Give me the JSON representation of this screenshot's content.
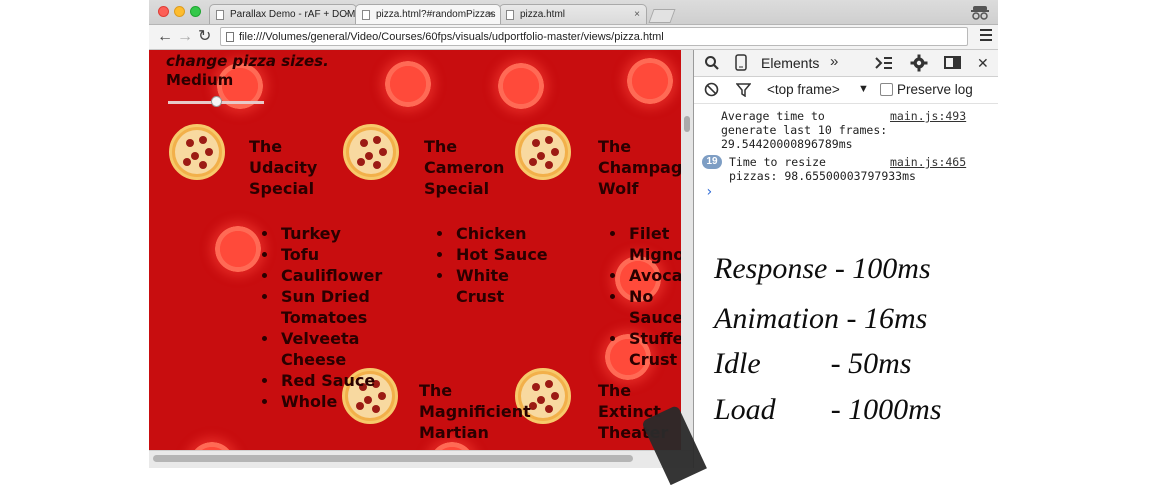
{
  "browser": {
    "tabs": [
      {
        "title": "Parallax Demo - rAF + DOM"
      },
      {
        "title": "pizza.html?#randomPizzas"
      },
      {
        "title": "pizza.html"
      }
    ],
    "close_glyph": "×",
    "url": "file:///Volumes/general/Video/Courses/60fps/visuals/udportfolio-master/views/pizza.html"
  },
  "page": {
    "header": "change pizza sizes.",
    "size_label": "Medium",
    "slider_level": 0.5,
    "pizzas": [
      {
        "name": [
          "The",
          "Udacity",
          "Special"
        ],
        "ingredients": [
          "Turkey",
          "Tofu",
          "Cauliflower",
          "Sun Dried Tomatoes",
          "Velveeta Cheese",
          "Red Sauce",
          "Whole"
        ]
      },
      {
        "name": [
          "The",
          "Cameron",
          "Special"
        ],
        "ingredients": [
          "Chicken",
          "Hot Sauce",
          "White Crust"
        ]
      },
      {
        "name": [
          "The",
          "Champag",
          "Wolf"
        ],
        "ingredients": [
          "Filet Migno",
          "Avoca",
          "No Sauce",
          "Stuffe Crust"
        ]
      },
      {
        "name": [
          "The",
          "Magnificient",
          "Martian"
        ],
        "ingredients": []
      },
      {
        "name": [
          "The",
          "Extinct",
          "Theater"
        ],
        "ingredients": []
      }
    ]
  },
  "devtools": {
    "panel_label": "Elements",
    "context": "<top frame>",
    "preserve_log": "Preserve log",
    "messages": [
      {
        "text": [
          "Average time to",
          "generate last 10 frames:",
          "29.54420000896789ms"
        ],
        "source": "main.js:493"
      },
      {
        "count": "19",
        "text": [
          "Time to resize",
          "pizzas: 98.65500003797933ms"
        ],
        "source": "main.js:465"
      }
    ]
  },
  "notes": [
    {
      "label": "Response",
      "value": "- 100ms"
    },
    {
      "label": "Animation",
      "value": "- 16ms"
    },
    {
      "label": "Idle",
      "value": "- 50ms"
    },
    {
      "label": "Load",
      "value": "- 1000ms"
    }
  ]
}
